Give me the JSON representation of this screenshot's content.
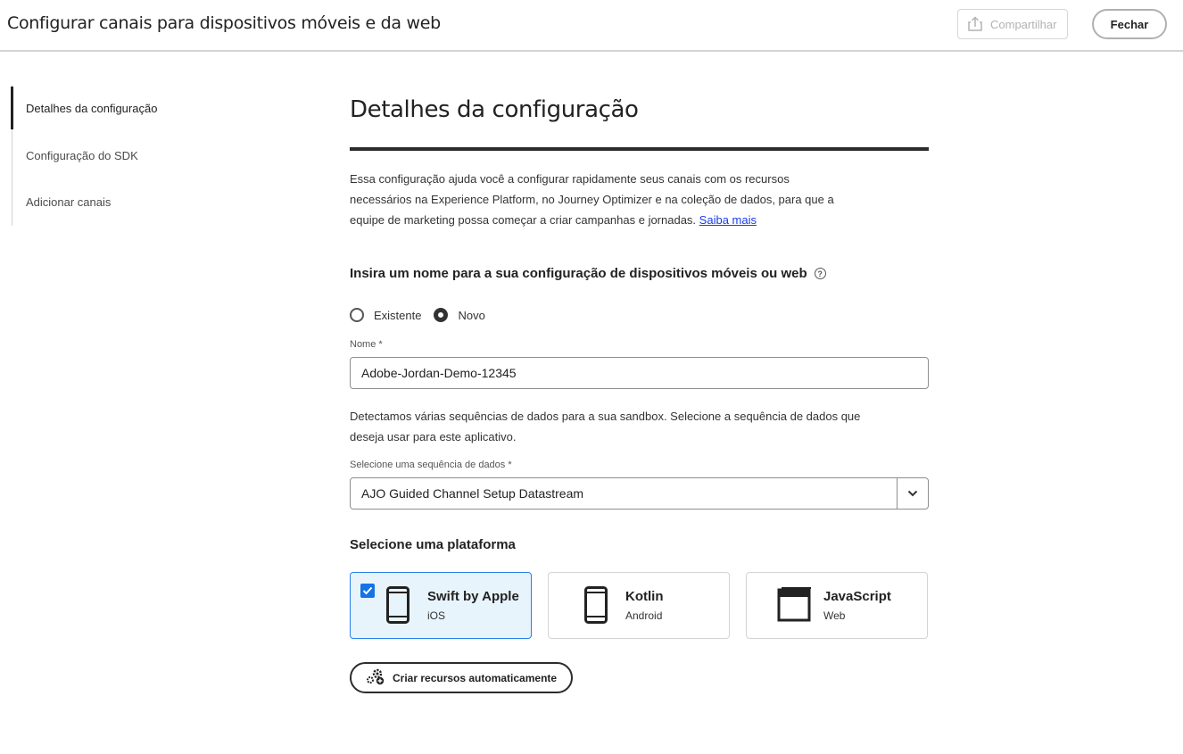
{
  "header": {
    "title": "Configurar canais para dispositivos móveis e da web",
    "share_label": "Compartilhar",
    "close_label": "Fechar"
  },
  "sidebar": {
    "items": [
      {
        "label": "Detalhes da configuração",
        "active": true
      },
      {
        "label": "Configuração do SDK",
        "active": false
      },
      {
        "label": "Adicionar canais",
        "active": false
      }
    ]
  },
  "main": {
    "title": "Detalhes da configuração",
    "intro": "Essa configuração ajuda você a configurar rapidamente seus canais com os recursos necessários na Experience Platform, no Journey Optimizer e na coleção de dados, para que a equipe de marketing possa começar a criar campanhas e jornadas.",
    "learn_more": "Saiba mais",
    "name_heading": "Insira um nome para a sua configuração de dispositivos móveis ou web",
    "radio_existing": "Existente",
    "radio_new": "Novo",
    "selected_radio": "Novo",
    "name_label": "Nome",
    "required_marker": "*",
    "name_value": "Adobe-Jordan-Demo-12345",
    "datastream_text": "Detectamos várias sequências de dados para a sua sandbox. Selecione a sequência de dados que deseja usar para este aplicativo.",
    "datastream_label": "Selecione uma sequência de dados",
    "datastream_value": "AJO Guided Channel Setup Datastream",
    "platform_heading": "Selecione uma plataforma",
    "platforms": [
      {
        "title": "Swift by Apple",
        "subtitle": "iOS",
        "selected": true,
        "icon": "phone-icon"
      },
      {
        "title": "Kotlin",
        "subtitle": "Android",
        "selected": false,
        "icon": "phone-icon"
      },
      {
        "title": "JavaScript",
        "subtitle": "Web",
        "selected": false,
        "icon": "browser-window-icon"
      }
    ],
    "create_button": "Criar recursos automaticamente"
  },
  "colors": {
    "accent": "#1473e6",
    "selected_card_bg": "#e8f4fc",
    "link": "#1a3be6",
    "rule": "#2c2c2c"
  }
}
